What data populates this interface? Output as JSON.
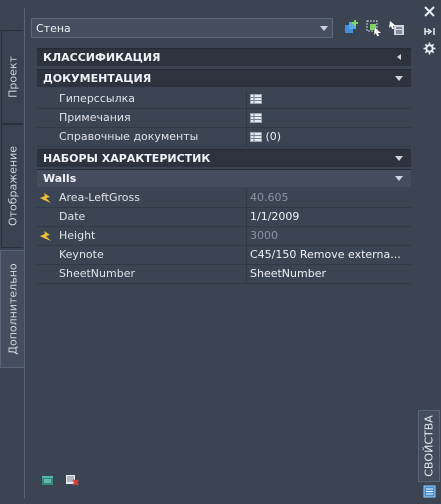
{
  "style_selector": {
    "value": "Стена"
  },
  "left_tabs": [
    {
      "label": "Проект"
    },
    {
      "label": "Отображение"
    },
    {
      "label": "Дополнительно"
    }
  ],
  "sections": {
    "classification": "КЛАССИФИКАЦИЯ",
    "documentation": "ДОКУМЕНТАЦИЯ",
    "property_sets": "НАБОРЫ ХАРАКТЕРИСТИК",
    "walls": "Walls"
  },
  "documentation_rows": [
    {
      "name": "Гиперссылка",
      "value": ""
    },
    {
      "name": "Примечания",
      "value": ""
    },
    {
      "name": "Справочные документы",
      "value": "(0)"
    }
  ],
  "walls_rows": [
    {
      "name": "Area-LeftGross",
      "value": "40.605",
      "icon": "lightning-icon"
    },
    {
      "name": "Date",
      "value": "1/1/2009",
      "icon": ""
    },
    {
      "name": "Height",
      "value": "3000",
      "icon": "lightning-icon"
    },
    {
      "name": "Keynote",
      "value": "C45/150 Remove externa...",
      "icon": ""
    },
    {
      "name": "SheetNumber",
      "value": "SheetNumber",
      "icon": ""
    }
  ],
  "palette_title": "СВОЙСТВА",
  "colors": {
    "background": "#3b4453",
    "section": "#2d333e",
    "accent_blue": "#3e8fd6"
  }
}
